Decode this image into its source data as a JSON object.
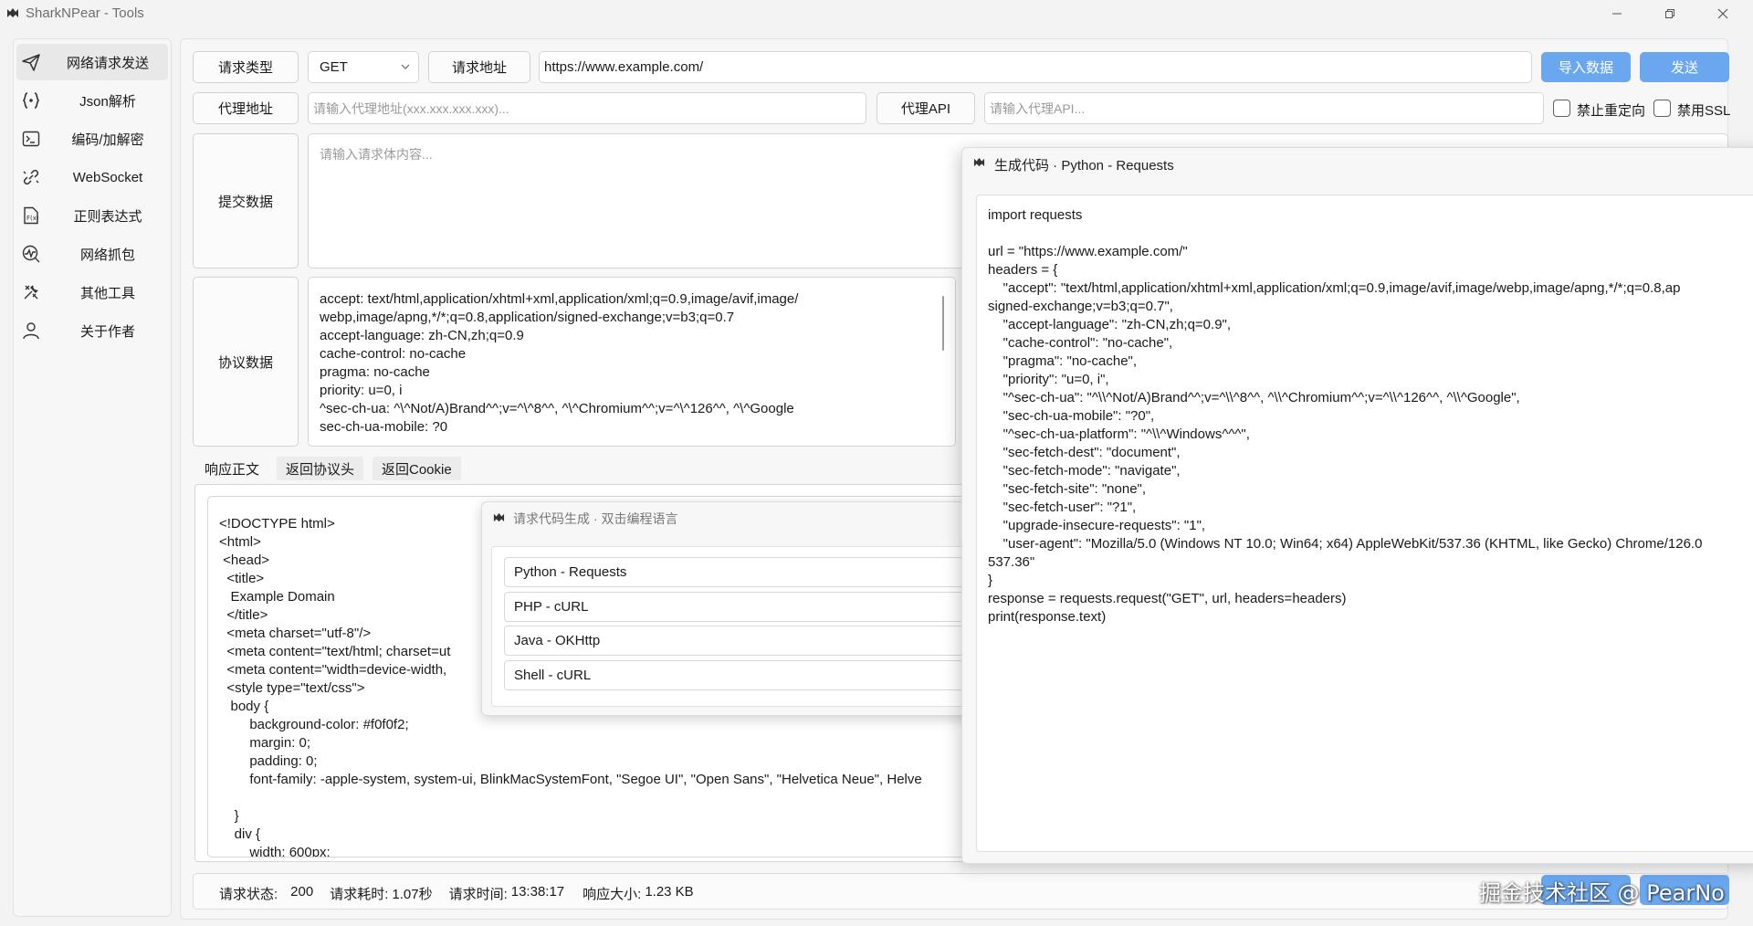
{
  "window": {
    "title": "SharkNPear - Tools"
  },
  "sidebar": {
    "items": [
      {
        "label": "网络请求发送",
        "icon": "send-icon"
      },
      {
        "label": "Json解析",
        "icon": "json-braces-icon"
      },
      {
        "label": "编码/加解密",
        "icon": "terminal-icon"
      },
      {
        "label": "WebSocket",
        "icon": "link-icon"
      },
      {
        "label": "正则表达式",
        "icon": "regex-document-icon"
      },
      {
        "label": "网络抓包",
        "icon": "network-capture-icon"
      },
      {
        "label": "其他工具",
        "icon": "tools-icon"
      },
      {
        "label": "关于作者",
        "icon": "person-icon"
      }
    ]
  },
  "request": {
    "method_label": "请求类型",
    "method_value": "GET",
    "url_label": "请求地址",
    "url_value": "https://www.example.com/",
    "import_button": "导入数据",
    "send_button": "发送",
    "proxy_label": "代理地址",
    "proxy_placeholder": "请输入代理地址(xxx.xxx.xxx.xxx)...",
    "proxy_api_label": "代理API",
    "proxy_api_placeholder": "请输入代理API...",
    "no_redirect_label": "禁止重定向",
    "disable_ssl_label": "禁用SSL",
    "body_label": "提交数据",
    "body_placeholder": "请输入请求体内容...",
    "headers_label": "协议数据",
    "headers_lines": [
      "accept: text/html,application/xhtml+xml,application/xml;q=0.9,image/avif,image/",
      "webp,image/apng,*/*;q=0.8,application/signed-exchange;v=b3;q=0.7",
      "accept-language: zh-CN,zh;q=0.9",
      "cache-control: no-cache",
      "pragma: no-cache",
      "priority: u=0, i",
      "^sec-ch-ua: ^\\^Not/A)Brand^^;v=^\\^8^^, ^\\^Chromium^^;v=^\\^126^^, ^\\^Google",
      "sec-ch-ua-mobile: ?0"
    ]
  },
  "response": {
    "tabs": [
      "响应正文",
      "返回协议头",
      "返回Cookie"
    ],
    "body_lines": [
      "<!DOCTYPE html>",
      "<html>",
      " <head>",
      "  <title>",
      "   Example Domain",
      "  </title>",
      "  <meta charset=\"utf-8\"/>",
      "  <meta content=\"text/html; charset=ut",
      "  <meta content=\"width=device-width,",
      "  <style type=\"text/css\">",
      "   body {",
      "        background-color: #f0f0f2;",
      "        margin: 0;",
      "        padding: 0;",
      "        font-family: -apple-system, system-ui, BlinkMacSystemFont, \"Segoe UI\", \"Open Sans\", \"Helvetica Neue\", Helve",
      "",
      "    }",
      "    div {",
      "        width: 600px;"
    ]
  },
  "codegen_dialog": {
    "title": "请求代码生成 · 双击编程语言",
    "languages": [
      "Python - Requests",
      "PHP - cURL",
      "Java - OKHttp",
      "Shell - cURL"
    ]
  },
  "code_window": {
    "title": "生成代码 · Python - Requests",
    "lines": [
      "import requests",
      "",
      "url = \"https://www.example.com/\"",
      "headers = {",
      "    \"accept\": \"text/html,application/xhtml+xml,application/xml;q=0.9,image/avif,image/webp,image/apng,*/*;q=0.8,ap",
      "signed-exchange;v=b3;q=0.7\",",
      "    \"accept-language\": \"zh-CN,zh;q=0.9\",",
      "    \"cache-control\": \"no-cache\",",
      "    \"pragma\": \"no-cache\",",
      "    \"priority\": \"u=0, i\",",
      "    \"^sec-ch-ua\": \"^\\\\^Not/A)Brand^^;v=^\\\\^8^^, ^\\\\^Chromium^^;v=^\\\\^126^^, ^\\\\^Google\",",
      "    \"sec-ch-ua-mobile\": \"?0\",",
      "    \"^sec-ch-ua-platform\": \"^\\\\^Windows^^^\",",
      "    \"sec-fetch-dest\": \"document\",",
      "    \"sec-fetch-mode\": \"navigate\",",
      "    \"sec-fetch-site\": \"none\",",
      "    \"sec-fetch-user\": \"?1\",",
      "    \"upgrade-insecure-requests\": \"1\",",
      "    \"user-agent\": \"Mozilla/5.0 (Windows NT 10.0; Win64; x64) AppleWebKit/537.36 (KHTML, like Gecko) Chrome/126.0",
      "537.36\"",
      "}",
      "response = requests.request(\"GET\", url, headers=headers)",
      "print(response.text)"
    ]
  },
  "status": {
    "state_label": "请求状态:",
    "state_value": "200",
    "elapsed_label": "请求耗时:",
    "elapsed_value": "1.07秒",
    "time_label": "请求时间:",
    "time_value": "13:38:17",
    "size_label": "响应大小:",
    "size_value": "1.23 KB"
  },
  "watermark": "掘金技术社区 @ PearNo",
  "colors": {
    "accent": "#6aa7ee",
    "background": "#f3f3f3"
  }
}
